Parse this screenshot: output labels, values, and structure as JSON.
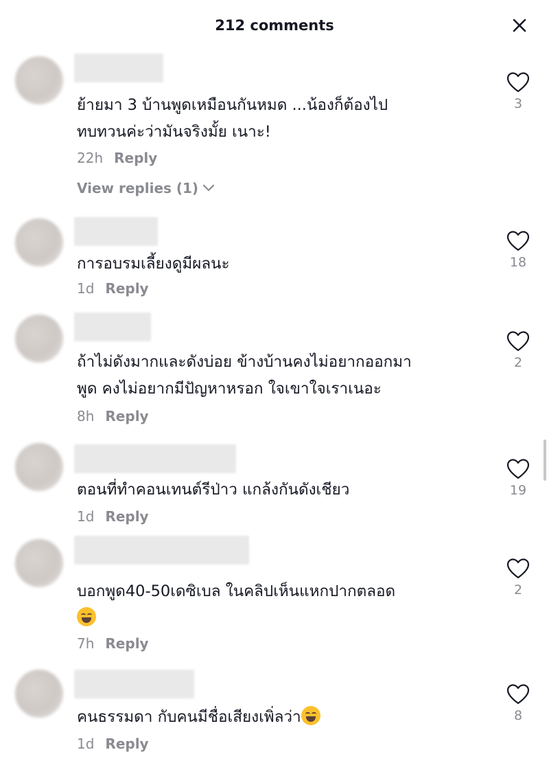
{
  "header": {
    "title": "212 comments",
    "close_label": "×"
  },
  "comments": [
    {
      "text_lines": [
        "ย้ายมา 3 บ้านพูดเหมือนกันหมด ...น้องก็ต้องไป",
        "ทบทวนค่ะว่ามันจริงมั้ย เนาะ!"
      ],
      "time": "22h",
      "reply_label": "Reply",
      "likes": "3"
    },
    {
      "text_lines": [
        "การอบรมเลี้ยงดูมีผลนะ"
      ],
      "time": "1d",
      "reply_label": "Reply",
      "likes": "18"
    },
    {
      "text_lines": [
        "ถ้าไม่ดังมากและดังบ่อย ข้างบ้านคงไม่อยากออกมา",
        "พูด คงไม่อยากมีปัญหาหรอก ใจเขาใจเราเนอะ"
      ],
      "time": "8h",
      "reply_label": "Reply",
      "likes": "2"
    },
    {
      "text_lines": [
        "ตอนที่ทำคอนเทนต์รีป่าว แกล้งกันดังเชียว"
      ],
      "time": "1d",
      "reply_label": "Reply",
      "likes": "19"
    },
    {
      "text_lines": [
        "บอกพูด40-50เดซิเบล ในคลิปเห็นแหกปากตลอด"
      ],
      "time": "7h",
      "reply_label": "Reply",
      "likes": "2"
    },
    {
      "text_lines": [
        "คนธรรมดา กับคนมีชื่อเสียงเพิ่ลว่า"
      ],
      "time": "1d",
      "reply_label": "Reply",
      "likes": "8"
    }
  ],
  "view_replies": {
    "label": "View replies (1)"
  },
  "icons": {
    "like": "heart-outline-icon",
    "close": "close-icon",
    "emoji": "tears-of-joy-emoji"
  },
  "colors": {
    "text": "#161823",
    "meta": "#8a8b91",
    "background": "#ffffff"
  }
}
